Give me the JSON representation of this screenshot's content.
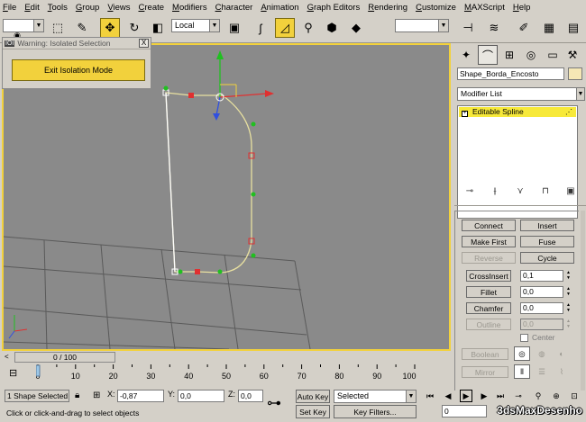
{
  "menu": [
    "File",
    "Edit",
    "Tools",
    "Group",
    "Views",
    "Create",
    "Modifiers",
    "Character",
    "Animation",
    "Graph Editors",
    "Rendering",
    "Customize",
    "MAXScript",
    "Help"
  ],
  "toolbar": {
    "undo_field": "",
    "coord_system": "Local",
    "named_selection": "",
    "icons": [
      "select-icon",
      "select-region-icon",
      "link-icon",
      "move-icon",
      "rotate-icon",
      "scale-icon",
      "pivot-icon",
      "snap-icon",
      "angle-snap-icon",
      "percent-snap-icon",
      "spinner-snap-icon",
      "mirror-icon",
      "align-icon",
      "layer-icon",
      "curve-editor-icon",
      "material-editor-icon",
      "render-setup-icon",
      "render-icon"
    ]
  },
  "isolation": {
    "title": "Warning: Isolated Selection",
    "tag": "IOI",
    "close": "X",
    "exit_label": "Exit Isolation Mode"
  },
  "command_panel": {
    "object_name": "Shape_Borda_Encosto",
    "modifier_list": "Modifier List",
    "stack_item": "Editable Spline",
    "stack_item_box": "+",
    "rollout": {
      "connect": "Connect",
      "insert": "Insert",
      "make_first": "Make First",
      "fuse": "Fuse",
      "reverse": "Reverse",
      "cycle": "Cycle",
      "crossinsert": "CrossInsert",
      "crossinsert_value": "0,1",
      "fillet": "Fillet",
      "fillet_value": "0,0",
      "chamfer": "Chamfer",
      "chamfer_value": "0,0",
      "outline": "Outline",
      "outline_value": "0,0",
      "center": "Center",
      "boolean": "Boolean",
      "mirror": "Mirror"
    }
  },
  "timeline": {
    "frame": "0 / 100",
    "ticks": [
      "0",
      "10",
      "20",
      "30",
      "40",
      "50",
      "60",
      "70",
      "80",
      "90",
      "100"
    ]
  },
  "status": {
    "selection": "1 Shape Selected",
    "x_label": "X:",
    "x_value": "-0,87",
    "y_label": "Y:",
    "y_value": "0,0",
    "z_label": "Z:",
    "z_value": "0,0",
    "auto_key": "Auto Key",
    "set_key": "Set Key",
    "key_mode": "Selected",
    "key_filters": "Key Filters...",
    "current_frame": "0",
    "prompt": "Click or click-and-drag to select objects",
    "watermark": "3dsMaxDesenho"
  }
}
